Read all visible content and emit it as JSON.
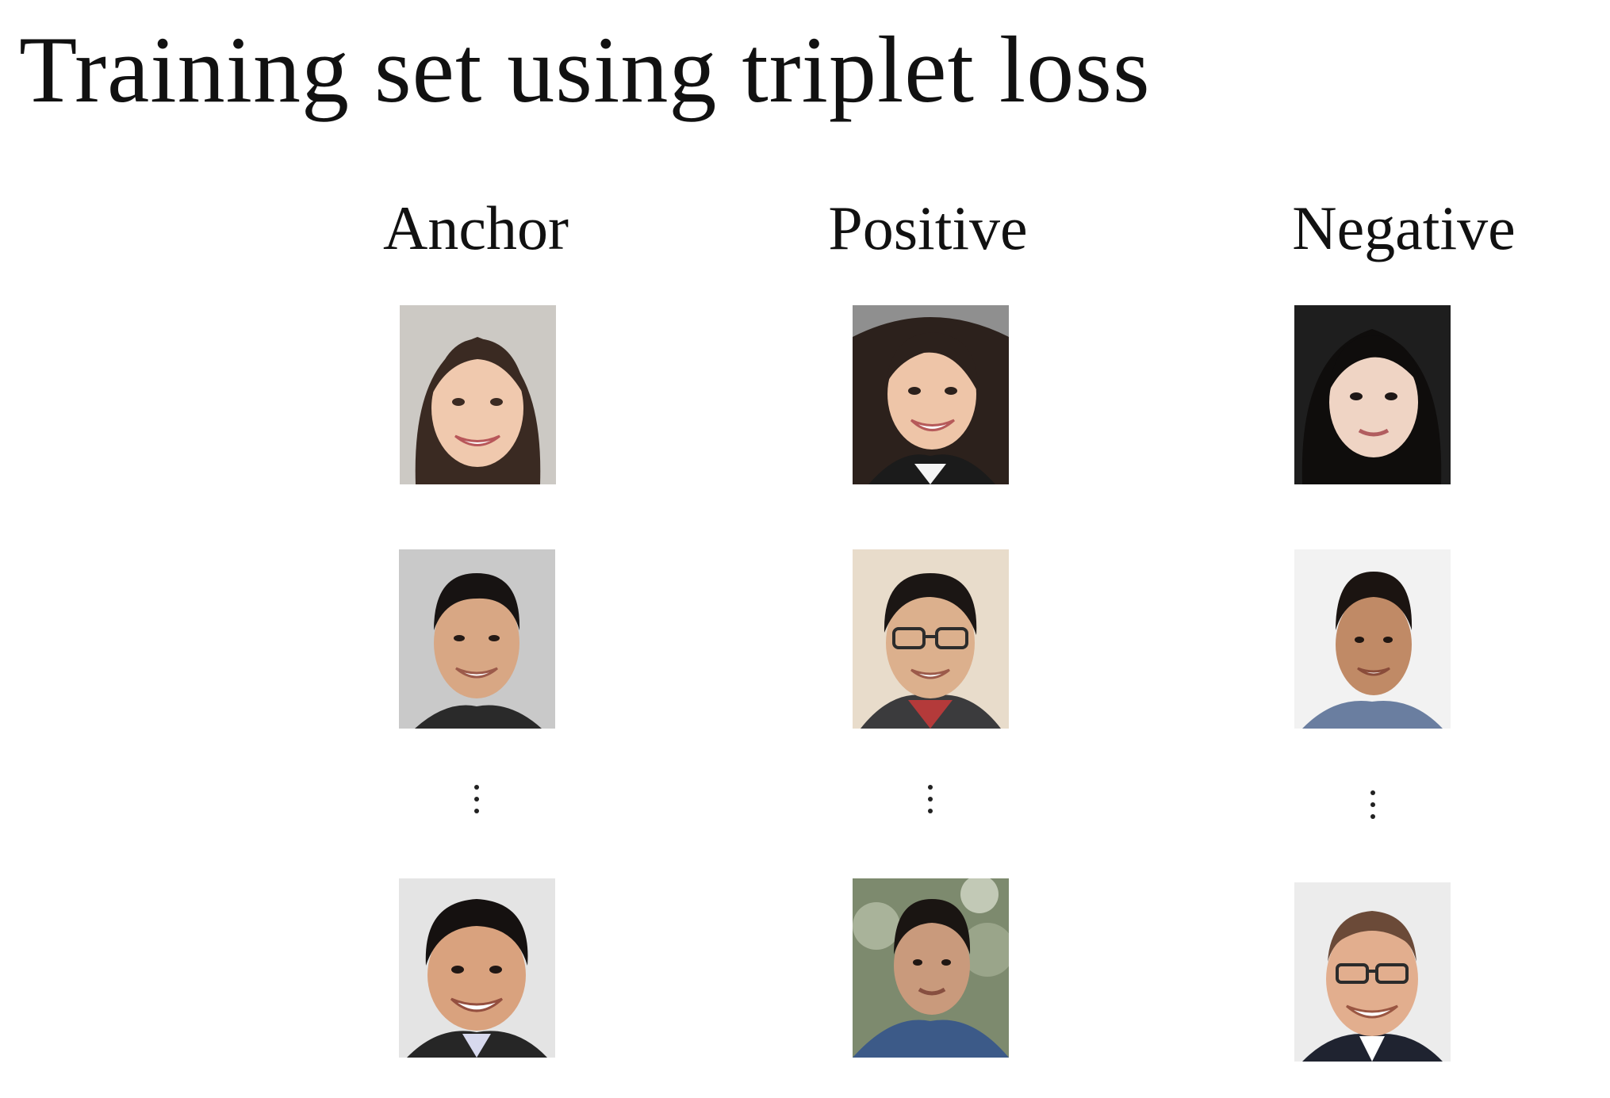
{
  "title": "Training set using triplet loss",
  "columns": [
    {
      "label": "Anchor"
    },
    {
      "label": "Positive"
    },
    {
      "label": "Negative"
    }
  ],
  "icons": {
    "face": "face-photo-icon",
    "ellipsis": "vertical-ellipsis-icon"
  }
}
